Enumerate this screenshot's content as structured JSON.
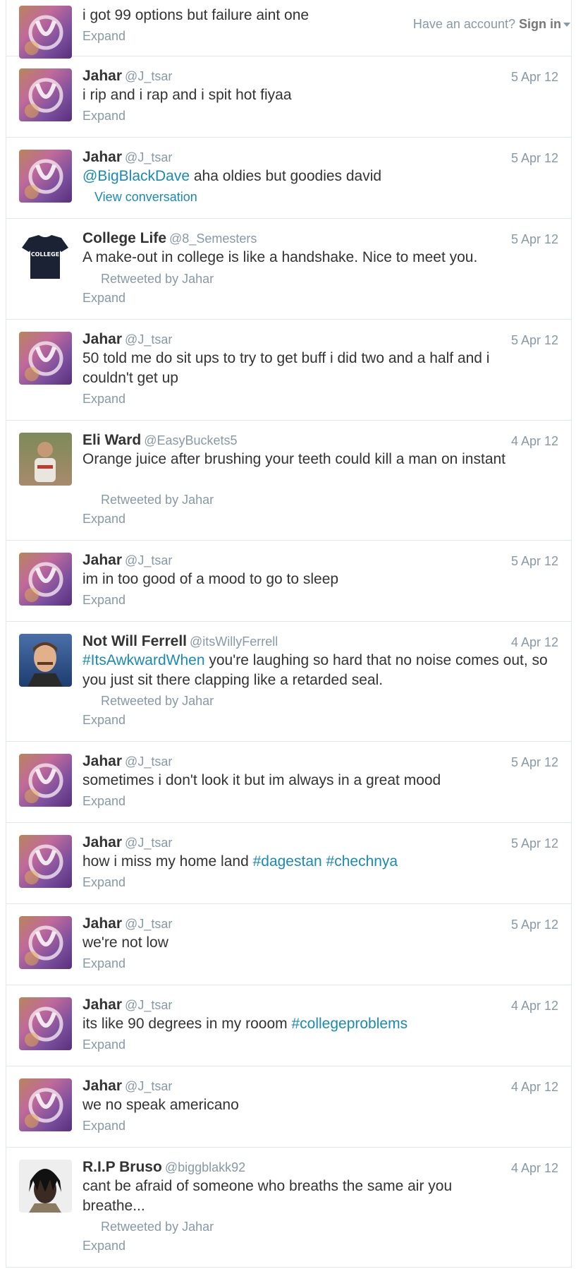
{
  "topbar": {
    "have_account": "Have an account?",
    "sign_in": "Sign in"
  },
  "common": {
    "expand": "Expand",
    "view_conversation": "View conversation"
  },
  "tweets": [
    {
      "text": "i got 99 options but failure aint one",
      "avatar": "jahar-avatar"
    },
    {
      "name": "Jahar",
      "handle": "@J_tsar",
      "date": "5 Apr 12",
      "text": "i rip and i rap and i spit hot fiyaa",
      "avatar": "jahar-avatar"
    },
    {
      "name": "Jahar",
      "handle": "@J_tsar",
      "date": "5 Apr 12",
      "mention": "@BigBlackDave",
      "text": " aha oldies but goodies david",
      "avatar": "jahar-avatar"
    },
    {
      "name": "College Life",
      "handle": "@8_Semesters",
      "date": "5 Apr 12",
      "text": "A make-out in college is like a handshake. Nice to meet you.",
      "retweeted_by": "Retweeted by Jahar",
      "avatar": "college-shirt-avatar"
    },
    {
      "name": "Jahar",
      "handle": "@J_tsar",
      "date": "5 Apr 12",
      "text": "50 told me do sit ups to try to get buff i did two and a half and i couldn't get up",
      "avatar": "jahar-avatar"
    },
    {
      "name": "Eli Ward",
      "handle": "@EasyBuckets5",
      "date": "4 Apr 12",
      "text": "Orange juice after brushing your teeth could kill a man on instant",
      "retweeted_by": "Retweeted by Jahar",
      "avatar": "eli-ward-avatar"
    },
    {
      "name": "Jahar",
      "handle": "@J_tsar",
      "date": "5 Apr 12",
      "text": "im in too good of a mood to go to sleep",
      "avatar": "jahar-avatar"
    },
    {
      "name": "Not Will Ferrell",
      "handle": "@itsWillyFerrell",
      "date": "4 Apr 12",
      "hashtag": "#ItsAwkwardWhen",
      "text": " you're laughing so hard that no noise comes out, so you just sit there clapping like a retarded seal.",
      "retweeted_by": "Retweeted by Jahar",
      "avatar": "will-ferrell-avatar"
    },
    {
      "name": "Jahar",
      "handle": "@J_tsar",
      "date": "5 Apr 12",
      "text": "sometimes i don't look it but im always in a great mood",
      "avatar": "jahar-avatar"
    },
    {
      "name": "Jahar",
      "handle": "@J_tsar",
      "date": "5 Apr 12",
      "text": "how i miss my home land ",
      "hashtag1": "#dagestan",
      "hashtag2": "#chechnya",
      "avatar": "jahar-avatar"
    },
    {
      "name": "Jahar",
      "handle": "@J_tsar",
      "date": "5 Apr 12",
      "text": "we're not low",
      "avatar": "jahar-avatar"
    },
    {
      "name": "Jahar",
      "handle": "@J_tsar",
      "date": "4 Apr 12",
      "text": "its like 90 degrees in my rooom ",
      "hashtag": "#collegeproblems",
      "avatar": "jahar-avatar"
    },
    {
      "name": "Jahar",
      "handle": "@J_tsar",
      "date": "4 Apr 12",
      "text": "we no speak americano",
      "avatar": "jahar-avatar"
    },
    {
      "name": "R.I.P Bruso",
      "handle": "@biggblakk92",
      "date": "4 Apr 12",
      "text": "cant be afraid of someone who breaths the same air you breathe...",
      "retweeted_by": "Retweeted by Jahar",
      "avatar": "bruso-avatar"
    }
  ]
}
